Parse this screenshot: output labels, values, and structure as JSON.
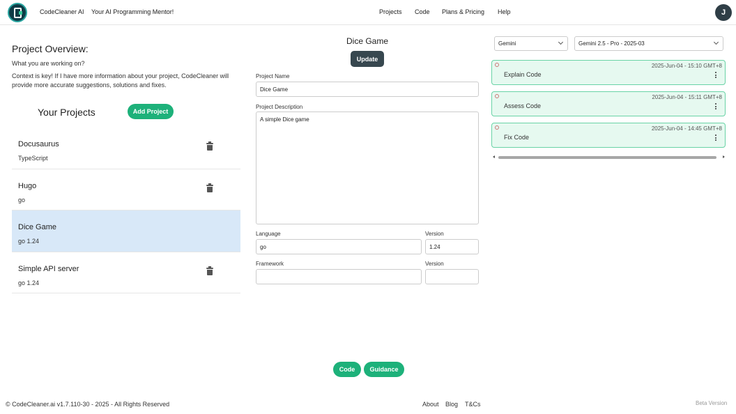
{
  "header": {
    "brand": "CodeCleaner AI",
    "tagline": "Your AI Programming Mentor!",
    "nav": [
      "Projects",
      "Code",
      "Plans & Pricing",
      "Help"
    ],
    "avatar_initial": "J"
  },
  "left": {
    "overview_title": "Project Overview:",
    "context_question": "What you are working on?",
    "context_desc": "Context is key! If I have more information about your project, CodeCleaner will provide more accurate suggestions, solutions and fixes.",
    "your_projects": "Your Projects",
    "add_project": "Add Project",
    "projects": [
      {
        "name": "Docusaurus",
        "lang": "TypeScript"
      },
      {
        "name": "Hugo",
        "lang": "go"
      },
      {
        "name": "Dice Game",
        "lang": "go  1.24",
        "selected": true
      },
      {
        "name": "Simple API server",
        "lang": "go  1.24"
      }
    ]
  },
  "middle": {
    "title": "Dice Game",
    "update": "Update",
    "project_name_label": "Project Name",
    "project_name_value": "Dice Game",
    "project_desc_label": "Project Description",
    "project_desc_value": "A simple Dice game",
    "language_label": "Language",
    "language_value": "go",
    "version_label": "Version",
    "version_value": "1.24",
    "framework_label": "Framework",
    "framework_value": "",
    "framework_version_label": "Version",
    "framework_version_value": "",
    "code_button": "Code",
    "guidance_button": "Guidance"
  },
  "right": {
    "provider": "Gemini",
    "model": "Gemini 2.5 - Pro - 2025-03",
    "sessions": [
      {
        "title": "Explain Code",
        "time": "2025-Jun-04 - 15:10 GMT+8"
      },
      {
        "title": "Assess Code",
        "time": "2025-Jun-04 - 15:11 GMT+8"
      },
      {
        "title": "Fix Code",
        "time": "2025-Jun-04 - 14:45 GMT+8"
      }
    ]
  },
  "footer": {
    "copyright": "© CodeCleaner.ai v1.7.110-30 - 2025 - All Rights Reserved",
    "links": [
      "About",
      "Blog",
      "T&Cs"
    ],
    "beta": "Beta Version"
  },
  "colors": {
    "accent": "#1db17a",
    "selected_row": "#d8e8f8",
    "card_bg": "#e6f9f0",
    "card_border": "#69d3a6",
    "dark_button": "#37474f"
  }
}
